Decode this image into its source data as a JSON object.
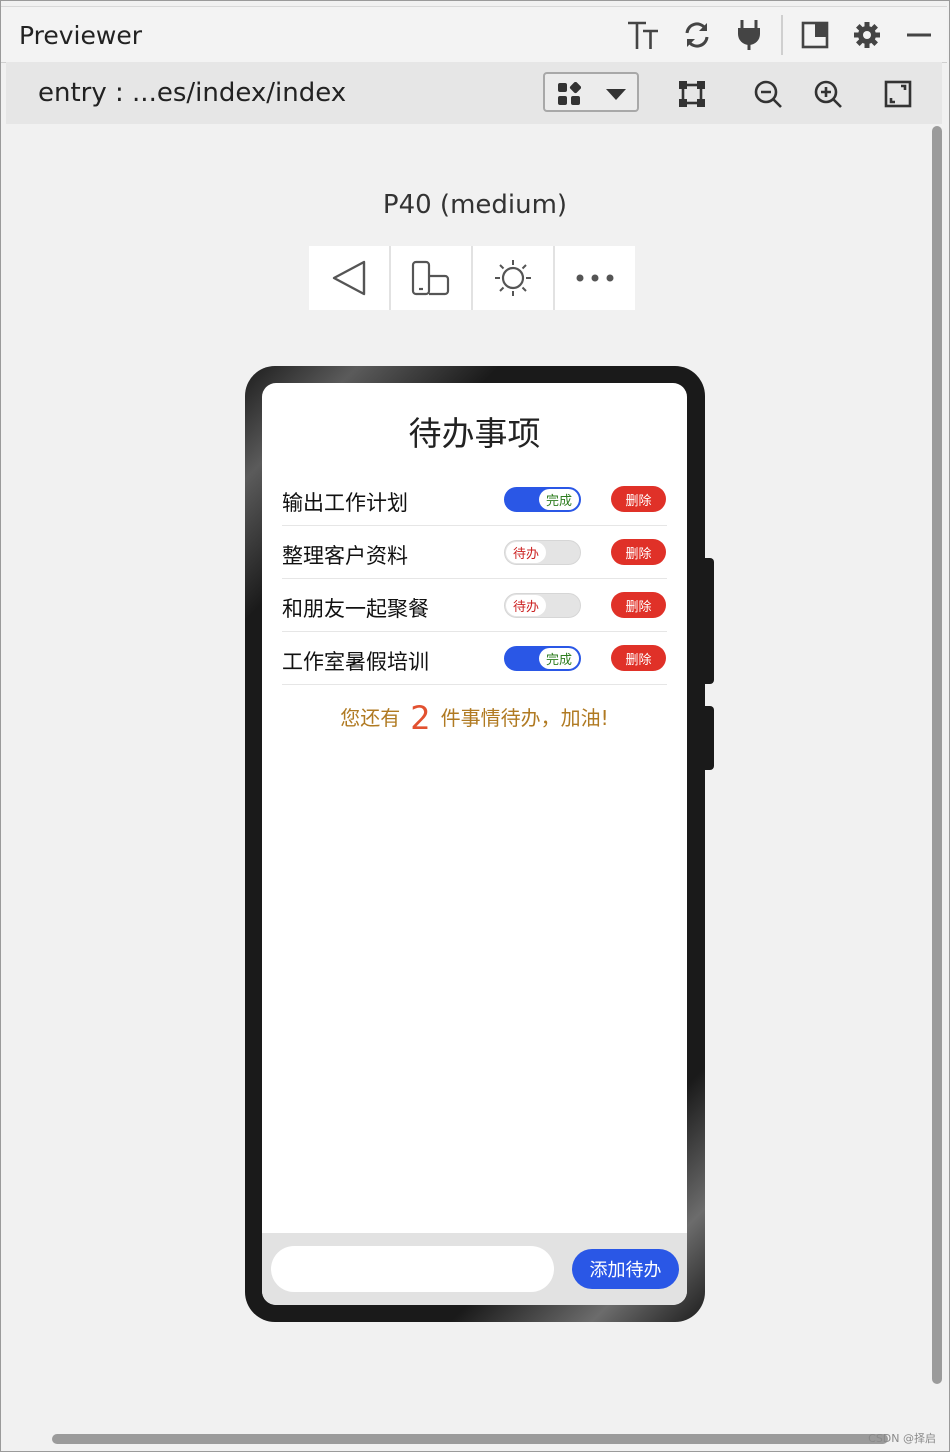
{
  "window": {
    "title": "Previewer",
    "icons": [
      "text-size-icon",
      "refresh-icon",
      "plug-icon",
      "panel-toggle-icon",
      "gear-icon",
      "minimize-icon"
    ]
  },
  "toolbar": {
    "path": "entry : ...es/index/index",
    "tools": [
      "layout-dropdown",
      "crop-frame-icon",
      "zoom-out-icon",
      "zoom-in-icon",
      "fit-screen-icon"
    ]
  },
  "device": {
    "name": "P40 (medium)",
    "controls": [
      "back-icon",
      "rotate-icon",
      "brightness-icon",
      "more-icon"
    ]
  },
  "app": {
    "title": "待办事项",
    "todos": [
      {
        "text": "输出工作计划",
        "status": "完成",
        "done": true,
        "delete_label": "删除"
      },
      {
        "text": "整理客户资料",
        "status": "待办",
        "done": false,
        "delete_label": "删除"
      },
      {
        "text": "和朋友一起聚餐",
        "status": "待办",
        "done": false,
        "delete_label": "删除"
      },
      {
        "text": "工作室暑假培训",
        "status": "完成",
        "done": true,
        "delete_label": "删除"
      }
    ],
    "summary": {
      "prefix": "您还有",
      "count": "2",
      "suffix": "件事情待办，加油!"
    },
    "input_value": "",
    "add_label": "添加待办"
  },
  "colors": {
    "accent": "#2a57e6",
    "delete": "#e03128",
    "summary": "#b07a22",
    "count": "#e25130"
  },
  "watermark": "CSDN @择启"
}
